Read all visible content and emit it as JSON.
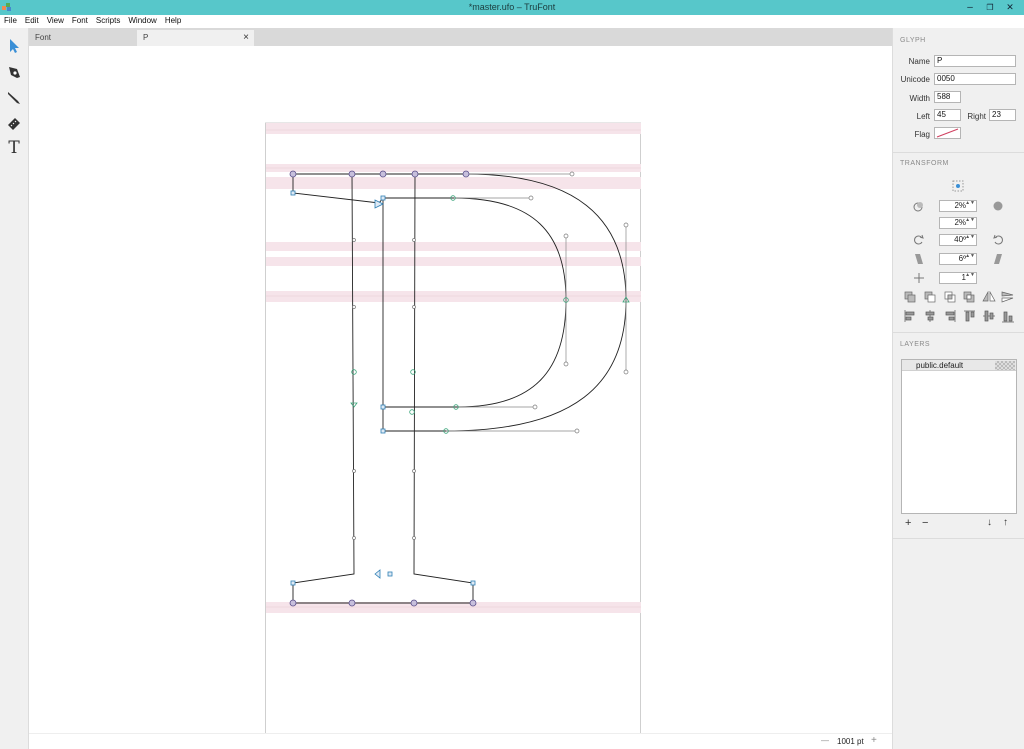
{
  "window": {
    "title": "*master.ufo – TruFont",
    "minimize_glyph": "–",
    "restore_glyph": "❐",
    "close_glyph": "✕"
  },
  "menu": [
    "File",
    "Edit",
    "View",
    "Font",
    "Scripts",
    "Window",
    "Help"
  ],
  "tools": [
    "pointer-tool-icon",
    "pen-tool-icon",
    "knife-tool-icon",
    "ruler-tool-icon",
    "text-tool-icon"
  ],
  "text_tool_glyph": "T",
  "tabs": [
    {
      "label": "Font",
      "closable": false
    },
    {
      "label": "P",
      "closable": true,
      "close_glyph": "×"
    }
  ],
  "status": {
    "zoom": "1001 pt",
    "zoom_out_glyph": "—",
    "zoom_in_glyph": "+"
  },
  "glyph_panel": {
    "section": "GLYPH",
    "name_label": "Name",
    "name_value": "P",
    "unicode_label": "Unicode",
    "unicode_value": "0050",
    "width_label": "Width",
    "width_value": "588",
    "left_label": "Left",
    "left_value": "45",
    "right_label": "Right",
    "right_value": "23",
    "flag_label": "Flag"
  },
  "transform_panel": {
    "section": "TRANSFORM",
    "move_value": "2%",
    "scale_value": "2%",
    "rotate_value": "40º",
    "skew_value": "6º",
    "snap_value": "1",
    "spin_arrows": "▲▼"
  },
  "layers_panel": {
    "section": "LAYERS",
    "layers": [
      {
        "name": "public.default"
      }
    ],
    "add_glyph": "+",
    "remove_glyph": "−",
    "down_glyph": "↓",
    "up_glyph": "↑"
  },
  "colors": {
    "titlebar": "#57c7ca",
    "metrics_band": "#f6e4ea",
    "outline": "#222222",
    "point_blue": "#2e7fb5",
    "point_green": "#3aa57a",
    "flag": "#d04060"
  }
}
